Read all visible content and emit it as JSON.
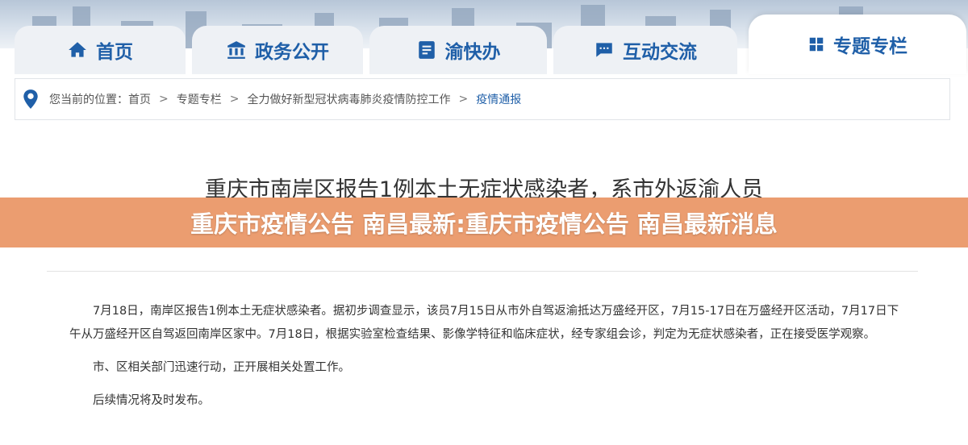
{
  "nav": {
    "tabs": [
      {
        "label": "首页",
        "icon": "home-icon"
      },
      {
        "label": "政务公开",
        "icon": "government-building-icon"
      },
      {
        "label": "渝快办",
        "icon": "checklist-icon"
      },
      {
        "label": "互动交流",
        "icon": "chat-bubble-icon"
      },
      {
        "label": "专题专栏",
        "icon": "grid-icon",
        "active": true
      }
    ]
  },
  "breadcrumb": {
    "prefix": "您当前的位置：",
    "items": [
      "首页",
      "专题专栏",
      "全力做好新型冠状病毒肺炎疫情防控工作"
    ],
    "separator": ">",
    "current": "疫情通报"
  },
  "article": {
    "title": "重庆市南岸区报告1例本土无症状感染者，系市外返渝人员",
    "paragraphs": [
      "7月18日，南岸区报告1例本土无症状感染者。据初步调查显示，该员7月15日从市外自驾返渝抵达万盛经开区，7月15-17日在万盛经开区活动，7月17日下午从万盛经开区自驾返回南岸区家中。7月18日，根据实验室检查结果、影像学特征和临床症状，经专家组会诊，判定为无症状感染者，正在接受医学观察。",
      "市、区相关部门迅速行动，正开展相关处置工作。",
      "后续情况将及时发布。"
    ]
  },
  "overlay": {
    "text": "重庆市疫情公告 南昌最新:重庆市疫情公告 南昌最新消息"
  },
  "colors": {
    "accent": "#1f5fa8",
    "overlay": "#e99260"
  }
}
